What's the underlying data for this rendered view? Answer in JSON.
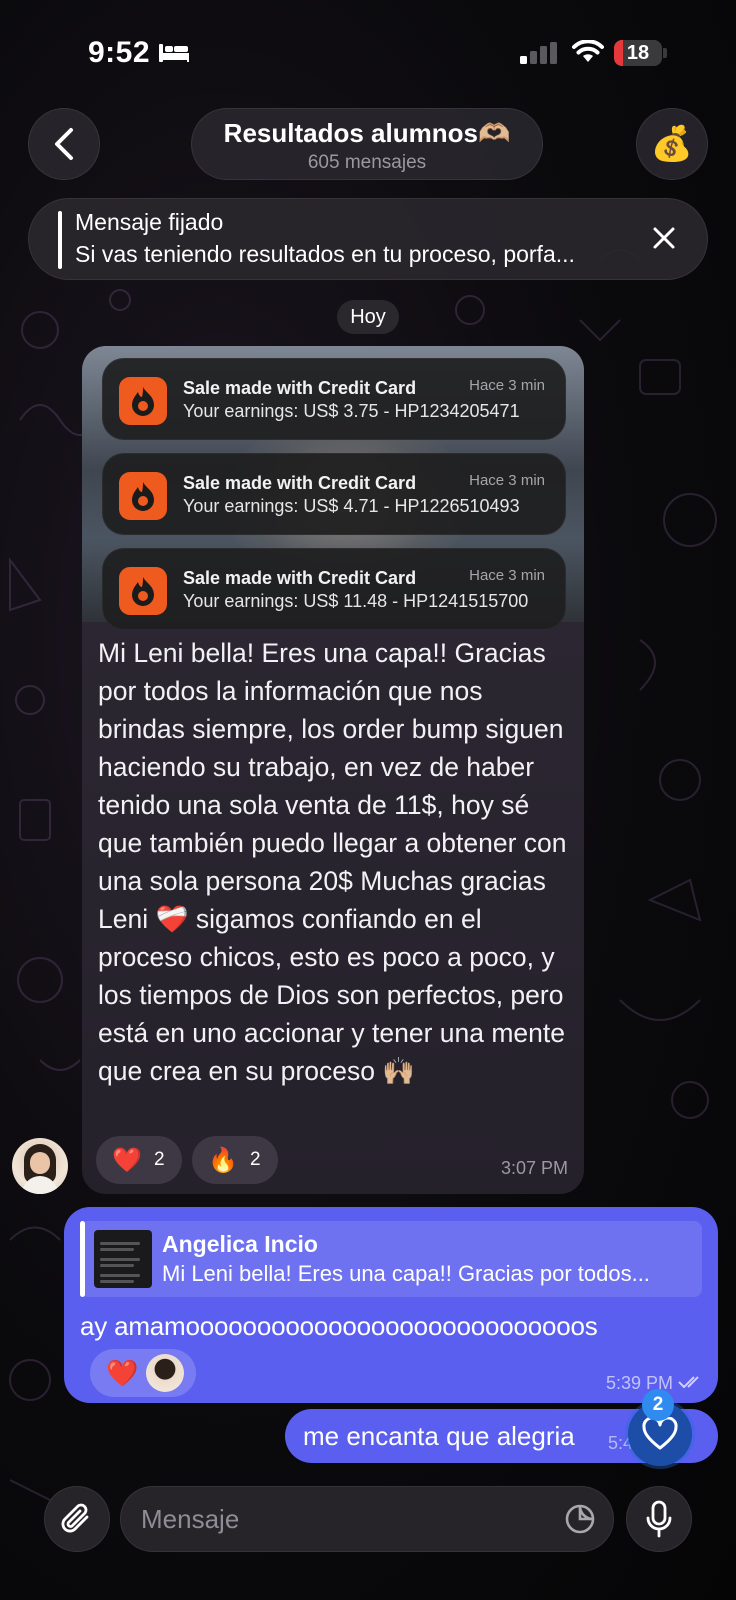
{
  "status_bar": {
    "time": "9:52",
    "battery": "18",
    "battery_level": 0.18,
    "battery_color": "#e5383b"
  },
  "header": {
    "title": "Resultados alumnos🫶🏼",
    "subtitle": "605 mensajes",
    "back_icon": "chevron-left-icon",
    "action_icon": "money-bag-icon"
  },
  "pinned": {
    "title": "Mensaje fijado",
    "text": "Si vas teniendo resultados en tu proceso, porfa..."
  },
  "date_separator": "Hoy",
  "incoming_message": {
    "notifications": [
      {
        "title": "Sale made with Credit Card",
        "time": "Hace 3 min",
        "body": "Your earnings: US$ 3.75 - HP1234205471"
      },
      {
        "title": "Sale made with Credit Card",
        "time": "Hace 3 min",
        "body": "Your earnings: US$ 4.71 - HP1226510493"
      },
      {
        "title": "Sale made with Credit Card",
        "time": "Hace 3 min",
        "body": "Your earnings: US$ 11.48 - HP1241515700"
      }
    ],
    "text": "Mi Leni bella! Eres una capa!! Gracias por todos la información que nos brindas siempre, los order bump siguen haciendo su trabajo, en vez de haber tenido una sola venta de 11$, hoy sé que también puedo llegar a obtener con una sola persona 20$ Muchas gracias Leni ❤️‍🩹 sigamos confiando en el proceso chicos, esto es poco a poco, y los tiempos de Dios son perfectos, pero está en uno accionar y tener una mente que crea en su proceso 🙌🏼",
    "reactions": [
      {
        "emoji": "❤️",
        "count": "2"
      },
      {
        "emoji": "🔥",
        "count": "2"
      }
    ],
    "time": "3:07 PM"
  },
  "reply_message": {
    "quote_name": "Angelica Incio",
    "quote_text": "Mi Leni bella! Eres una capa!! Gracias por todos...",
    "text": "ay amamoooooooooooooooooooooooooooos",
    "reaction_emoji": "❤️",
    "time": "5:39 PM"
  },
  "second_message": {
    "text": "me encanta que alegria",
    "time": "5:4"
  },
  "reaction_badge": {
    "count": "2",
    "icon": "heart-outline-icon"
  },
  "input": {
    "placeholder": "Mensaje"
  },
  "colors": {
    "outgoing_bubble": "#5b5ff0",
    "incoming_bubble": "#2b2731",
    "badge": "#2f8bf0",
    "notification_icon": "#ef5a1f"
  }
}
